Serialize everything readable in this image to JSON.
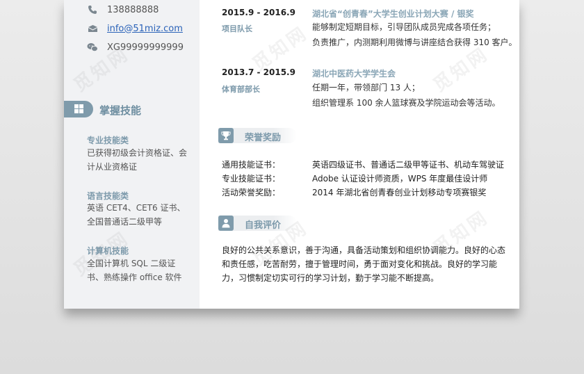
{
  "contact": {
    "phone": "138888888",
    "email": "info@51miz.com",
    "wechat": "XG99999999999"
  },
  "skills": {
    "title": "掌握技能",
    "groups": [
      {
        "head": "专业技能类",
        "text": "已获得初级会计资格证、会计从业资格证"
      },
      {
        "head": "语言技能类",
        "text": "英语 CET4、CET6 证书、全国普通话二级甲等"
      },
      {
        "head": "计算机技能",
        "text": "全国计算机 SQL 二级证书、熟练操作 office 软件"
      }
    ]
  },
  "experience": [
    {
      "date": "2015.9 - 2016.9",
      "role": "项目队长",
      "org": "湖北省“创青春”大学生创业计划大赛 / 银奖",
      "desc": [
        "能够制定短期目标，引导团队成员完成各项任务；",
        "负责推广，内测期利用微博与讲座结合获得 310 客户。"
      ]
    },
    {
      "date": "2013.7 - 2015.9",
      "role": "体育部部长",
      "org": "湖北中医药大学学生会",
      "desc": [
        "任期一年，带领部门 13 人；",
        "组织管理系 100 余人篮球赛及学院运动会等活动。"
      ]
    }
  ],
  "honors": {
    "title": "荣誉奖励",
    "items": [
      {
        "label": "通用技能证书：",
        "value": "英语四级证书、普通话二级甲等证书、机动车驾驶证"
      },
      {
        "label": "专业技能证书：",
        "value": "Adobe 认证设计师资质，WPS 年度最佳设计师"
      },
      {
        "label": "活动荣誉奖励：",
        "value": "2014 年湖北省创青春创业计划移动专项赛银奖"
      }
    ]
  },
  "self_eval": {
    "title": "自我评价",
    "text": "良好的公共关系意识，善于沟通，具备活动策划和组织协调能力。良好的心态和责任感，吃苦耐劳，擅于管理时间，勇于面对变化和挑战。良好的学习能力，习惯制定切实可行的学习计划，勤于学习能不断提高。"
  },
  "watermark": "觅知网"
}
